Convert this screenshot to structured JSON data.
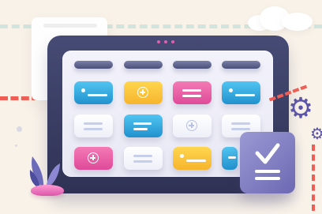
{
  "scene": {
    "kind": "task board illustration",
    "palette": {
      "background": "#f8f2e9",
      "device": "#3e4268",
      "screen": "#eeedf8",
      "blue": "#2b9ad6",
      "yellow": "#ffc83c",
      "pink": "#ef5fa8",
      "purple": "#7d79c2",
      "red_dash": "#ef5e55",
      "mint_dash": "#cfe4dd"
    }
  },
  "board": {
    "rows": [
      [
        "header",
        "header",
        "header",
        "header"
      ],
      [
        "blue-note",
        "yellow-add",
        "pink-lines",
        "blue-note"
      ],
      [
        "white-lines",
        "blue-lines",
        "white-add",
        "white-lines"
      ],
      [
        "pink-add",
        "white-lines",
        "yellow-note",
        "blue-partial"
      ]
    ]
  },
  "icons": {
    "add": "plus-circle-icon",
    "approve": "check-list-icon",
    "settings": "gear-icon"
  }
}
